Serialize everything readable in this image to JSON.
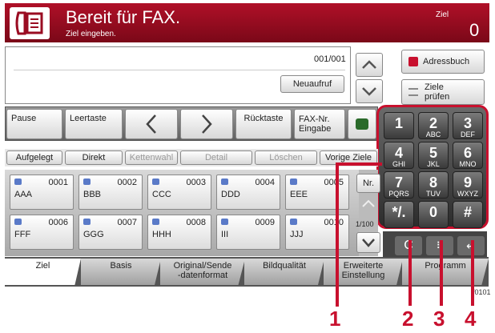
{
  "header": {
    "title": "Bereit für FAX.",
    "subtitle": "Ziel eingeben.",
    "target_label": "Ziel",
    "target_count": "0"
  },
  "dest": {
    "page": "001/001",
    "recall": "Neuaufruf"
  },
  "side": {
    "addressbook": "Adressbuch",
    "check": "Ziele\nprüfen"
  },
  "toolbar": {
    "pause": "Pause",
    "space": "Leertaste",
    "backspace": "Rücktaste",
    "faxnr": "FAX-Nr.\nEingabe"
  },
  "dialbar": {
    "onhook": "Aufgelegt",
    "direct": "Direkt",
    "chain": "Kettenwahl",
    "detail": "Detail",
    "delete": "Löschen",
    "prev": "Vorige Ziele"
  },
  "favorites": [
    {
      "num": "0001",
      "name": "AAA"
    },
    {
      "num": "0002",
      "name": "BBB"
    },
    {
      "num": "0003",
      "name": "CCC"
    },
    {
      "num": "0004",
      "name": "DDD"
    },
    {
      "num": "0005",
      "name": "EEE"
    },
    {
      "num": "0006",
      "name": "FFF"
    },
    {
      "num": "0007",
      "name": "GGG"
    },
    {
      "num": "0008",
      "name": "HHH"
    },
    {
      "num": "0009",
      "name": "III"
    },
    {
      "num": "0010",
      "name": "JJJ"
    }
  ],
  "fav_side": {
    "nr": "Nr.",
    "page": "1/100"
  },
  "tabs": [
    "Ziel",
    "Basis",
    "Original/Sende\n-datenformat",
    "Bildqualität",
    "Erweiterte\nEinstellung",
    "Programm"
  ],
  "keypad": [
    {
      "d": "1",
      "l": ""
    },
    {
      "d": "2",
      "l": "ABC"
    },
    {
      "d": "3",
      "l": "DEF"
    },
    {
      "d": "4",
      "l": "GHI"
    },
    {
      "d": "5",
      "l": "JKL"
    },
    {
      "d": "6",
      "l": "MNO"
    },
    {
      "d": "7",
      "l": "PQRS"
    },
    {
      "d": "8",
      "l": "TUV"
    },
    {
      "d": "9",
      "l": "WXYZ"
    },
    {
      "d": "*/.",
      "l": ""
    },
    {
      "d": "0",
      "l": ""
    },
    {
      "d": "#",
      "l": ""
    }
  ],
  "figure_id": "f0101",
  "callouts": [
    "1",
    "2",
    "3",
    "4"
  ],
  "colors": {
    "accent": "#c8102e",
    "header": "#9a0c22"
  }
}
